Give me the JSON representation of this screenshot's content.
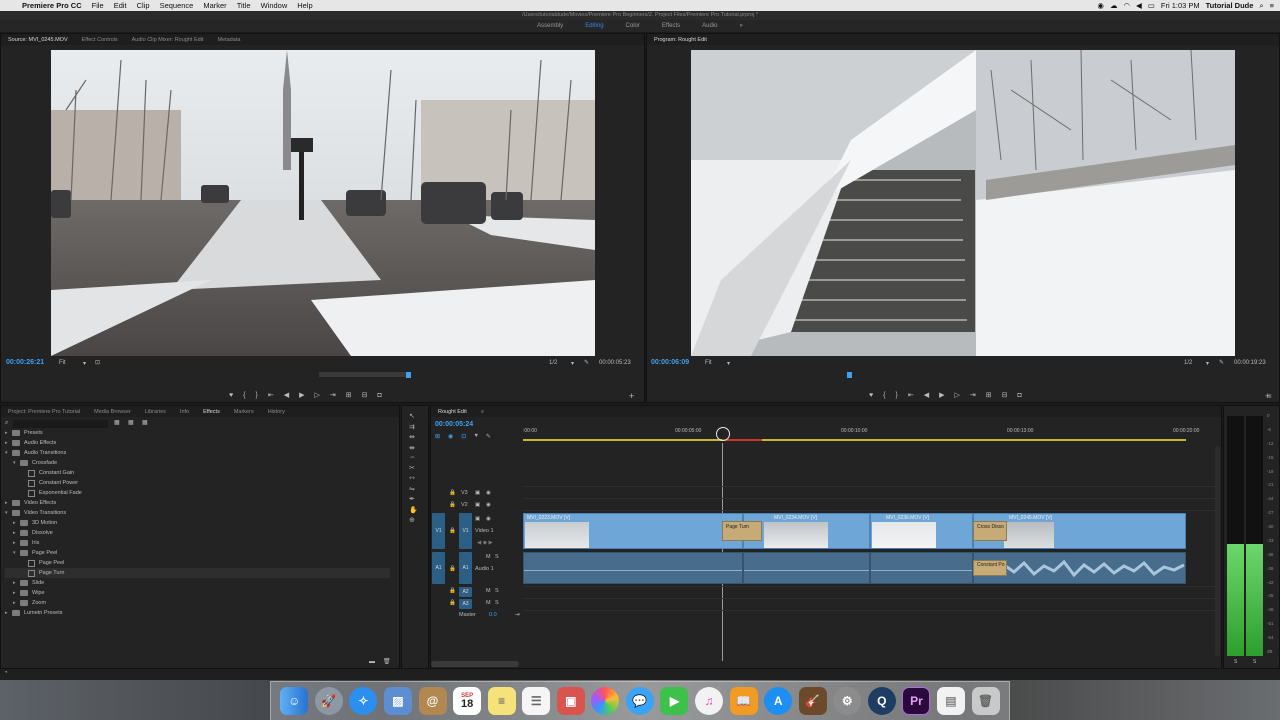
{
  "menubar": {
    "app_name": "Premiere Pro CC",
    "items": [
      "File",
      "Edit",
      "Clip",
      "Sequence",
      "Marker",
      "Title",
      "Window",
      "Help"
    ],
    "clock": "Fri 1:03 PM",
    "user": "Tutorial Dude"
  },
  "title": "/Users/tutorialdude/Movies/Premiere Pro Beginners/2. Project Files/Premiere Pro Tutorial.prproj *",
  "workspaces": {
    "items": [
      "Assembly",
      "Editing",
      "Color",
      "Effects",
      "Audio"
    ],
    "active": "Editing",
    "more": "»"
  },
  "source": {
    "tabs": [
      "Source: MVI_0245.MOV",
      "Effect Controls",
      "Audio Clip Mixer: Rought Edit",
      "Metadata"
    ],
    "timecode": "00:00:26:21",
    "fit": "Fit",
    "resolution": "1/2",
    "duration": "00:00:05:23"
  },
  "program": {
    "tab": "Program: Rought Edit",
    "timecode": "00:00:06:09",
    "fit": "Fit",
    "resolution": "1/2",
    "duration": "00:00:19:23"
  },
  "project": {
    "tabs": [
      "Project: Premiere Pro Tutorial",
      "Media Browser",
      "Libraries",
      "Info",
      "Effects",
      "Markers",
      "History"
    ],
    "active_tab": "Effects",
    "tree": [
      {
        "label": "Presets",
        "depth": 0,
        "kind": "folder",
        "open": false
      },
      {
        "label": "Audio Effects",
        "depth": 0,
        "kind": "folder",
        "open": false
      },
      {
        "label": "Audio Transitions",
        "depth": 0,
        "kind": "folder",
        "open": true
      },
      {
        "label": "Crossfade",
        "depth": 1,
        "kind": "folder",
        "open": true
      },
      {
        "label": "Constant Gain",
        "depth": 2,
        "kind": "fx"
      },
      {
        "label": "Constant Power",
        "depth": 2,
        "kind": "fx"
      },
      {
        "label": "Exponential Fade",
        "depth": 2,
        "kind": "fx"
      },
      {
        "label": "Video Effects",
        "depth": 0,
        "kind": "folder",
        "open": false
      },
      {
        "label": "Video Transitions",
        "depth": 0,
        "kind": "folder",
        "open": true
      },
      {
        "label": "3D Motion",
        "depth": 1,
        "kind": "folder",
        "open": false
      },
      {
        "label": "Dissolve",
        "depth": 1,
        "kind": "folder",
        "open": false
      },
      {
        "label": "Iris",
        "depth": 1,
        "kind": "folder",
        "open": false
      },
      {
        "label": "Page Peel",
        "depth": 1,
        "kind": "folder",
        "open": true
      },
      {
        "label": "Page Peel",
        "depth": 2,
        "kind": "fx"
      },
      {
        "label": "Page Turn",
        "depth": 2,
        "kind": "fx",
        "selected": true
      },
      {
        "label": "Slide",
        "depth": 1,
        "kind": "folder",
        "open": false
      },
      {
        "label": "Wipe",
        "depth": 1,
        "kind": "folder",
        "open": false
      },
      {
        "label": "Zoom",
        "depth": 1,
        "kind": "folder",
        "open": false
      },
      {
        "label": "Lumetri Presets",
        "depth": 0,
        "kind": "folder",
        "open": false
      }
    ]
  },
  "timeline": {
    "tab": "Rought Edit",
    "timecode": "00:00:05:24",
    "ruler": [
      ":00:00",
      "00:00:05:00",
      "00:00:10:00",
      "00:00:13:00",
      "00:00:20:00"
    ],
    "tracks": {
      "v3": "V3",
      "v2": "V2",
      "v1": "V1",
      "v1_name": "Video 1",
      "a1": "A1",
      "a1_name": "Audio 1",
      "a2": "A2",
      "a3": "A3",
      "master": "Master",
      "master_val": "0.0",
      "src_v1": "V1",
      "src_a1": "A1",
      "m": "M",
      "s": "S"
    },
    "clips": [
      {
        "name": "MVI_0223.MOV [V]"
      },
      {
        "name": "MVI_0234.MOV [V]"
      },
      {
        "name": "MVI_0236.MOV [V]"
      },
      {
        "name": "MVI_0245.MOV [V]"
      }
    ],
    "transitions": [
      "Page Turn",
      "Cross Disso"
    ],
    "audio_transition": "Constant Po"
  },
  "meter": {
    "ticks": [
      "0",
      "-6",
      "-12",
      "-15",
      "-18",
      "-21",
      "-24",
      "-27",
      "-30",
      "-33",
      "-36",
      "-39",
      "-42",
      "-45",
      "-48",
      "-51",
      "-54",
      "dB"
    ],
    "s_left": "S",
    "s_right": "S"
  },
  "dock": {
    "calendar_month": "SEP",
    "calendar_day": "18",
    "premiere": "Pr"
  }
}
